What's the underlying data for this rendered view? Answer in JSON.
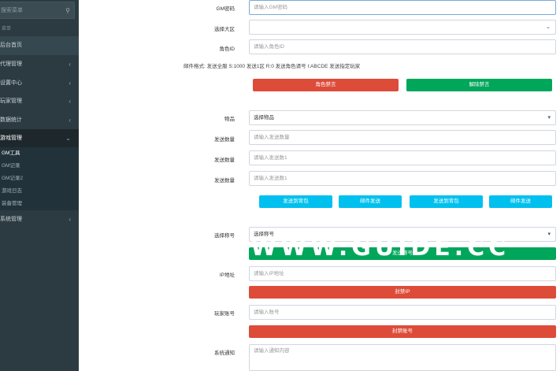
{
  "sidebar": {
    "search_placeholder": "搜索菜单",
    "header": "菜单",
    "items": [
      {
        "label": "后台首页"
      },
      {
        "label": "代理管理"
      },
      {
        "label": "设置中心"
      },
      {
        "label": "玩家管理"
      },
      {
        "label": "数据统计"
      },
      {
        "label": "游戏管理"
      },
      {
        "label": "系统管理"
      }
    ],
    "sub_items": [
      {
        "label": "GM工具"
      },
      {
        "label": "GM记录"
      },
      {
        "label": "GM记录2"
      },
      {
        "label": "游戏日志"
      },
      {
        "label": "装备管理"
      }
    ]
  },
  "form": {
    "gm_password": {
      "label": "GM密码",
      "placeholder": "请输入GM密码"
    },
    "region": {
      "label": "选择大区",
      "value": ""
    },
    "role_id": {
      "label": "角色ID",
      "placeholder": "请输入角色ID"
    },
    "mail_format": "邮件格式: 发送全服 S:1000 发送1区 R:0 发送角色请号 I:ABCDE 发送指定玩家",
    "ban_role": "角色禁言",
    "unban": "解除禁言",
    "item": {
      "label": "物品",
      "value": "选择物品"
    },
    "qty1": {
      "label": "发送数量",
      "placeholder": "请输入发送数量"
    },
    "qty2": {
      "label": "发送数量",
      "placeholder": "请输入发送数1"
    },
    "qty3": {
      "label": "发送数量",
      "placeholder": "请输入发送数1"
    },
    "send_buttons": [
      "发送到背包",
      "邮件发送",
      "发送到背包",
      "邮件发送"
    ],
    "title": {
      "label": "选择称号",
      "value": "选择称号"
    },
    "title_button": "发送称号",
    "ip": {
      "label": "IP地址",
      "placeholder": "请输入IP地址"
    },
    "ban_ip": "封禁IP",
    "account": {
      "label": "玩家账号",
      "placeholder": "请输入账号"
    },
    "ban_account": "封禁账号",
    "notice": {
      "label": "系统通知",
      "placeholder": "请输入通知内容"
    }
  },
  "watermark": "WWW.GUIDE.CC",
  "colors": {
    "sidebar": "#2c3b41",
    "red": "#dd4b39",
    "green": "#00a65a",
    "blue": "#00c0ef"
  }
}
